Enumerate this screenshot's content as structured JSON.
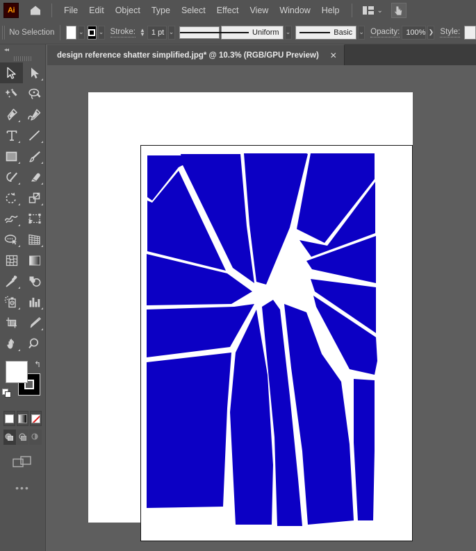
{
  "app": {
    "name": "Ai",
    "logo_bg": "#330000",
    "logo_fg": "#ff9a00"
  },
  "menubar": {
    "home_icon": "home-icon",
    "items": [
      "File",
      "Edit",
      "Object",
      "Type",
      "Select",
      "Effect",
      "View",
      "Window",
      "Help"
    ],
    "arrange_icon": "arrange-documents-icon",
    "arrange_chevron": "⌄",
    "cursor_icon": "touch-cursor-icon"
  },
  "controlbar": {
    "selection_status": "No Selection",
    "fill_color": "#ffffff",
    "stroke_color": "#000000",
    "fill_dropdown": "⌄",
    "stroke_dropdown": "⌄",
    "stroke_label": "Stroke:",
    "stroke_weight": "1 pt",
    "stroke_weight_dropdown": "⌄",
    "variable_width_profile": "Uniform",
    "variable_width_dropdown": "⌄",
    "brush_definition": "Basic",
    "brush_dropdown": "⌄",
    "opacity_label": "Opacity:",
    "opacity_value": "100%",
    "opacity_arrow": "❯",
    "style_label": "Style:"
  },
  "tabbar": {
    "tab_title": "design reference shatter simplified.jpg* @  10.3% (RGB/GPU Preview)",
    "close_glyph": "✕"
  },
  "toolbar": {
    "collapse_glyph": "◂◂",
    "tools": [
      {
        "name": "selection-tool",
        "active": true,
        "has_flyout": false
      },
      {
        "name": "direct-selection-tool",
        "active": false,
        "has_flyout": true
      },
      {
        "name": "magic-wand-tool",
        "active": false,
        "has_flyout": false
      },
      {
        "name": "lasso-tool",
        "active": false,
        "has_flyout": false
      },
      {
        "name": "pen-tool",
        "active": false,
        "has_flyout": true
      },
      {
        "name": "curvature-tool",
        "active": false,
        "has_flyout": false
      },
      {
        "name": "type-tool",
        "active": false,
        "has_flyout": true
      },
      {
        "name": "line-segment-tool",
        "active": false,
        "has_flyout": true
      },
      {
        "name": "rectangle-tool",
        "active": false,
        "has_flyout": true
      },
      {
        "name": "paintbrush-tool",
        "active": false,
        "has_flyout": true
      },
      {
        "name": "shaper-tool",
        "active": false,
        "has_flyout": true
      },
      {
        "name": "eraser-tool",
        "active": false,
        "has_flyout": true
      },
      {
        "name": "rotate-tool",
        "active": false,
        "has_flyout": true
      },
      {
        "name": "scale-tool",
        "active": false,
        "has_flyout": true
      },
      {
        "name": "width-tool",
        "active": false,
        "has_flyout": true
      },
      {
        "name": "free-transform-tool",
        "active": false,
        "has_flyout": false
      },
      {
        "name": "shape-builder-tool",
        "active": false,
        "has_flyout": true
      },
      {
        "name": "perspective-grid-tool",
        "active": false,
        "has_flyout": true
      },
      {
        "name": "mesh-tool",
        "active": false,
        "has_flyout": false
      },
      {
        "name": "gradient-tool",
        "active": false,
        "has_flyout": false
      },
      {
        "name": "eyedropper-tool",
        "active": false,
        "has_flyout": true
      },
      {
        "name": "blend-tool",
        "active": false,
        "has_flyout": false
      },
      {
        "name": "symbol-sprayer-tool",
        "active": false,
        "has_flyout": true
      },
      {
        "name": "column-graph-tool",
        "active": false,
        "has_flyout": true
      },
      {
        "name": "artboard-tool",
        "active": false,
        "has_flyout": false
      },
      {
        "name": "slice-tool",
        "active": false,
        "has_flyout": true
      },
      {
        "name": "hand-tool",
        "active": false,
        "has_flyout": true
      },
      {
        "name": "zoom-tool",
        "active": false,
        "has_flyout": false
      }
    ],
    "fill_color": "#ffffff",
    "stroke_color": "#000000",
    "swap_glyph": "↰",
    "color_modes": [
      {
        "name": "color-swatch-button",
        "selected": false
      },
      {
        "name": "gradient-swatch-button",
        "selected": false
      },
      {
        "name": "none-swatch-button",
        "selected": false
      }
    ],
    "draw_modes": [
      {
        "name": "draw-normal-button",
        "selected": true
      },
      {
        "name": "draw-behind-button",
        "selected": false
      },
      {
        "name": "draw-inside-button",
        "selected": false
      }
    ],
    "screen_mode_icon": "change-screen-mode-icon",
    "more_tools_glyph": "•••"
  },
  "artwork": {
    "title": "shatter-starburst",
    "fill_color": "#0c00c4",
    "background": "#ffffff",
    "artboard_border": "#121212",
    "description": "Blue starburst / shatter pattern radiating from an off-center hub with white crack gaps"
  }
}
